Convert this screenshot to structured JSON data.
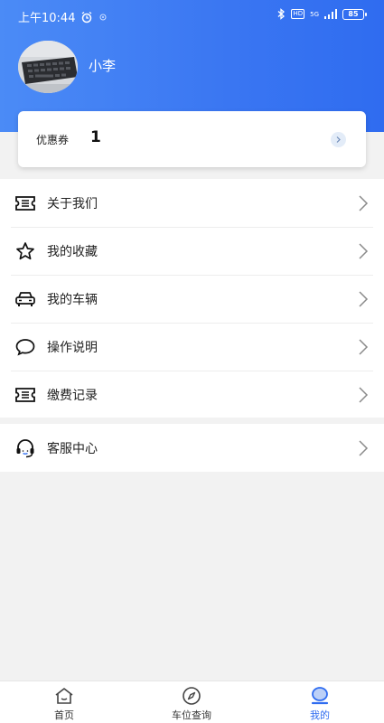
{
  "status_bar": {
    "time": "上午10:44",
    "network": "5G",
    "hd": "HD",
    "battery": "85"
  },
  "profile": {
    "username": "小李"
  },
  "coupon": {
    "label": "优惠券",
    "count": "1"
  },
  "menu": {
    "items": [
      {
        "label": "关于我们",
        "icon": "ticket-icon"
      },
      {
        "label": "我的收藏",
        "icon": "star-icon"
      },
      {
        "label": "我的车辆",
        "icon": "car-icon"
      },
      {
        "label": "操作说明",
        "icon": "speech-bubble-icon"
      },
      {
        "label": "缴费记录",
        "icon": "ticket-icon"
      }
    ],
    "service": {
      "label": "客服中心",
      "icon": "headset-icon"
    }
  },
  "tabbar": {
    "tabs": [
      {
        "label": "首页",
        "icon": "home-icon"
      },
      {
        "label": "车位查询",
        "icon": "compass-icon"
      },
      {
        "label": "我的",
        "icon": "profile-icon",
        "active": true
      }
    ]
  },
  "colors": {
    "brand": "#3a76f2",
    "active_tab": "#2f6cf0"
  }
}
